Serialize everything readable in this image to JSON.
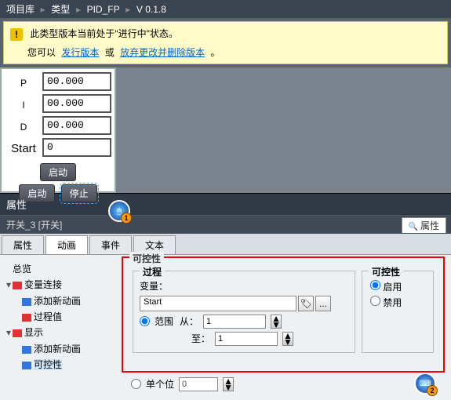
{
  "breadcrumb": {
    "a": "项目库",
    "b": "类型",
    "c": "PID_FP",
    "d": "V 0.1.8"
  },
  "alert": {
    "line1": "此类型版本当前处于\"进行中\"状态。",
    "line2a": "您可以",
    "link1": "发行版本",
    "or": "或",
    "link2": "放弃更改并删除版本",
    "dot": "。"
  },
  "pid": {
    "labels": {
      "p": "P",
      "i": "I",
      "d": "D",
      "start": "Start"
    },
    "values": {
      "p": "00.000",
      "i": "00.000",
      "d": "00.000",
      "start": "0"
    },
    "btns": {
      "run1": "启动",
      "run2": "启动",
      "stop": "停止"
    }
  },
  "propHeader": "属性",
  "subHeader": "开关_3 [开关]",
  "subPropTab": "属性",
  "tabs": {
    "t1": "属性",
    "t2": "动画",
    "t3": "事件",
    "t4": "文本"
  },
  "tree": {
    "overview": "总览",
    "varconn": "变量连接",
    "addanim1": "添加新动画",
    "procval": "过程值",
    "display": "显示",
    "addanim2": "添加新动画",
    "control": "可控性"
  },
  "panel": {
    "groupTitle": "可控性",
    "process": "过程",
    "varLabel": "变量：",
    "varValue": "Start",
    "range": "范围",
    "from": "从：",
    "fromVal": "1",
    "to": "至：",
    "toVal": "1",
    "single": "单个位",
    "singleVal": "0",
    "ctlTitle": "可控性",
    "enable": "启用",
    "disable": "禁用"
  },
  "badges": {
    "b1": "1",
    "b2": "2"
  }
}
